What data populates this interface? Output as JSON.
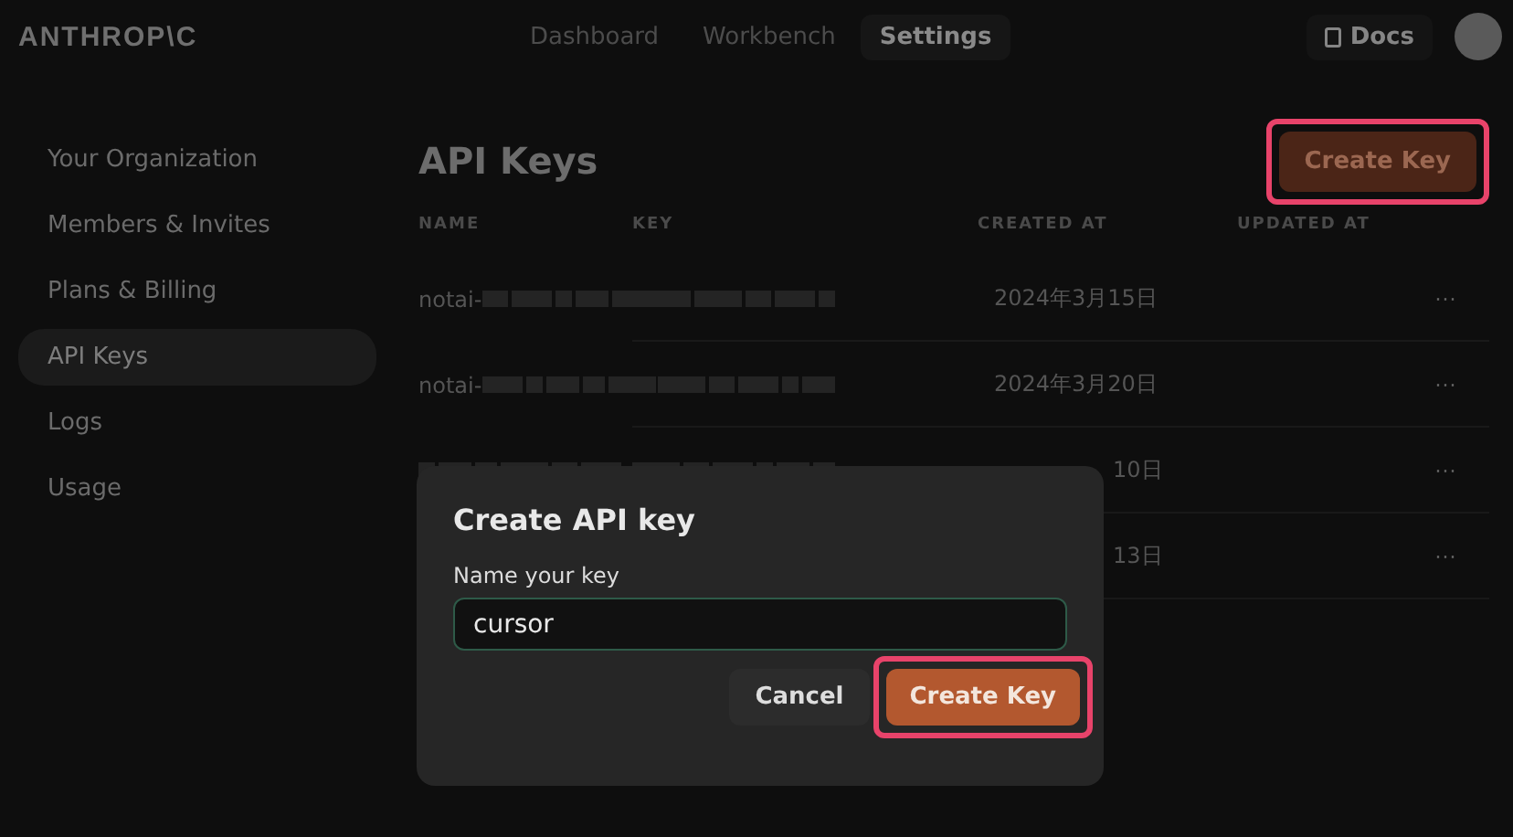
{
  "header": {
    "logo": "ANTHROP\\C",
    "nav": [
      {
        "label": "Dashboard",
        "selected": false
      },
      {
        "label": "Workbench",
        "selected": false
      },
      {
        "label": "Settings",
        "selected": true
      }
    ],
    "docs": "Docs"
  },
  "sidebar": {
    "items": [
      {
        "label": "Your Organization",
        "selected": false
      },
      {
        "label": "Members & Invites",
        "selected": false
      },
      {
        "label": "Plans & Billing",
        "selected": false
      },
      {
        "label": "API Keys",
        "selected": true
      },
      {
        "label": "Logs",
        "selected": false
      },
      {
        "label": "Usage",
        "selected": false
      }
    ]
  },
  "page": {
    "title": "API Keys",
    "create_button": {
      "label": "Create Key",
      "highlighted": true
    }
  },
  "table": {
    "columns": [
      "NAME",
      "KEY",
      "CREATED AT",
      "UPDATED AT"
    ],
    "rows": [
      {
        "name": "notai-",
        "redacted": true,
        "created_at": "2024年3月15日",
        "menu": "···"
      },
      {
        "name": "notai-",
        "redacted": true,
        "created_at": "2024年3月20日",
        "menu": "···"
      },
      {
        "redacted": true,
        "covered": true,
        "created_at": "10日",
        "menu": "···"
      },
      {
        "covered": true,
        "created_at": "13日",
        "menu": "···"
      }
    ]
  },
  "dialog": {
    "title": "Create API key",
    "field_label": "Name your key",
    "value": "cursor",
    "cancel": "Cancel",
    "confirm": {
      "label": "Create Key",
      "highlighted": true
    }
  }
}
